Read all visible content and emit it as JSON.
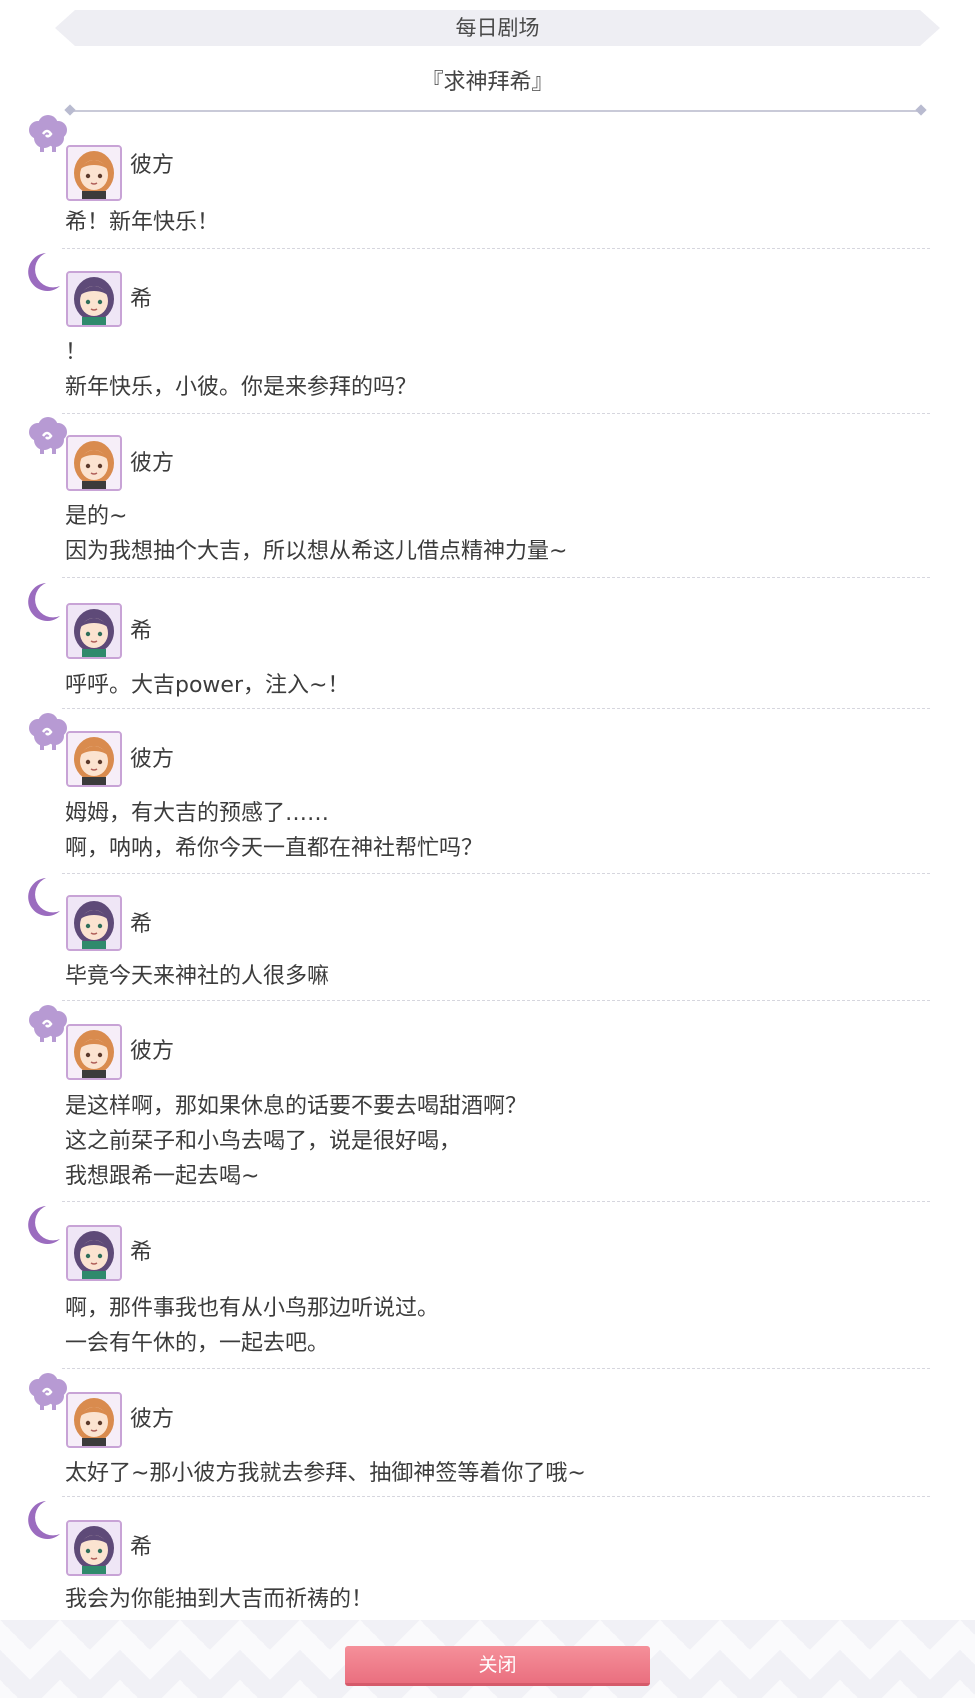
{
  "header": {
    "title": "每日剧场"
  },
  "story": {
    "title": "『求神拜希』"
  },
  "speakers": {
    "kanata": {
      "name": "彼方",
      "icon": "sheep-icon",
      "color": "#b79ad3"
    },
    "nozomi": {
      "name": "希",
      "icon": "crescent-moon-icon",
      "color": "#9b6cbf"
    }
  },
  "dialogue": [
    {
      "name": "彼方",
      "lines": [
        "希！新年快乐！"
      ]
    },
    {
      "name": "希",
      "lines": [
        "！",
        "新年快乐，小彼。你是来参拜的吗？"
      ]
    },
    {
      "name": "彼方",
      "lines": [
        "是的~",
        "因为我想抽个大吉，所以想从希这儿借点精神力量~"
      ]
    },
    {
      "name": "希",
      "lines": [
        "呼呼。大吉power，注入~！"
      ]
    },
    {
      "name": "彼方",
      "lines": [
        "姆姆，有大吉的预感了……",
        "啊，呐呐，希你今天一直都在神社帮忙吗？"
      ]
    },
    {
      "name": "希",
      "lines": [
        "毕竟今天来神社的人很多嘛"
      ]
    },
    {
      "name": "彼方",
      "lines": [
        "是这样啊，那如果休息的话要不要去喝甜酒啊？",
        "这之前栞子和小鸟去喝了，说是很好喝，",
        "我想跟希一起去喝~"
      ]
    },
    {
      "name": "希",
      "lines": [
        "啊，那件事我也有从小鸟那边听说过。",
        "一会有午休的，一起去吧。"
      ]
    },
    {
      "name": "彼方",
      "lines": [
        "太好了~那小彼方我就去参拜、抽御神签等着你了哦~"
      ]
    },
    {
      "name": "希",
      "lines": [
        "我会为你能抽到大吉而祈祷的！"
      ]
    }
  ],
  "footer": {
    "close_label": "关闭"
  }
}
